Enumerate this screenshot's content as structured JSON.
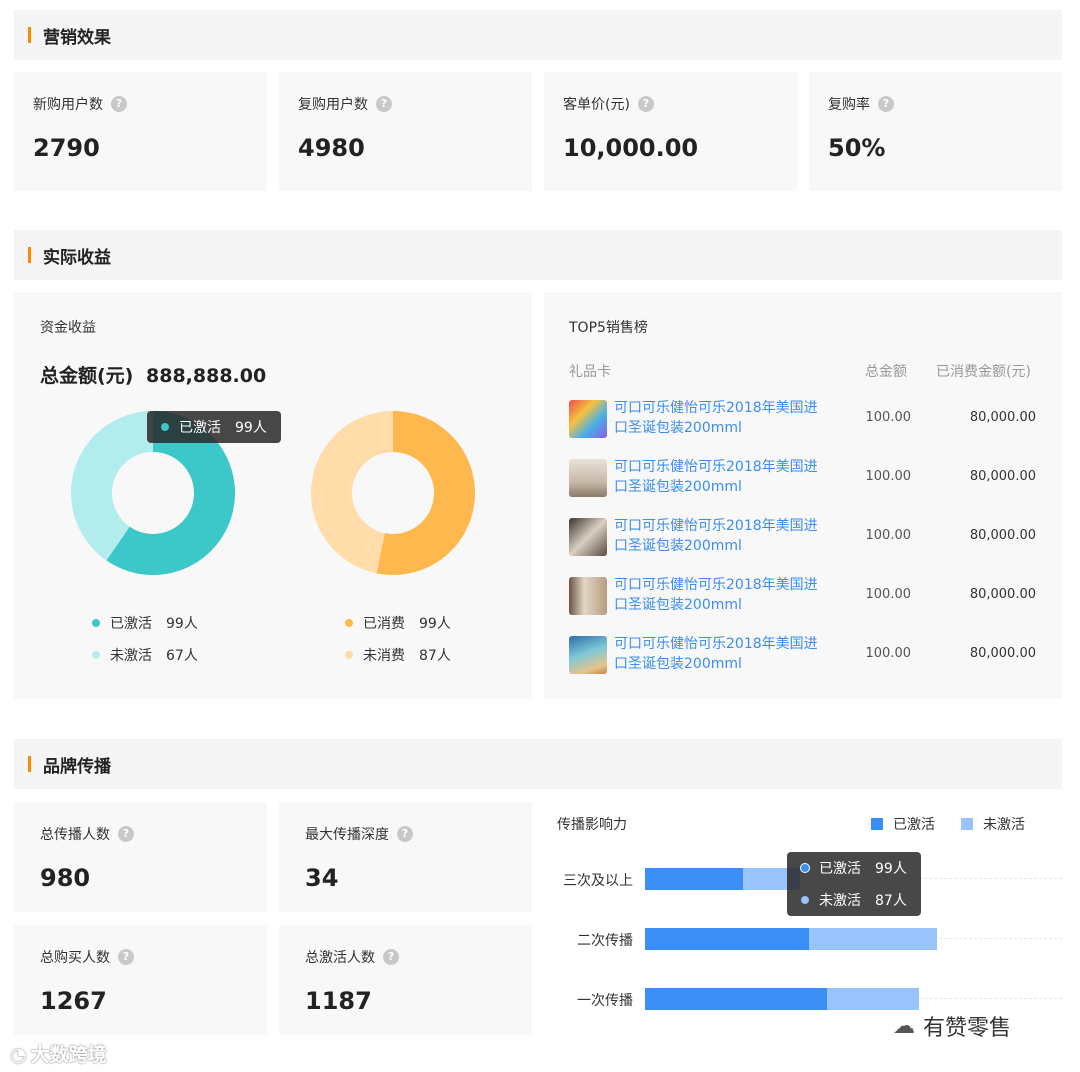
{
  "colors": {
    "accent": "#ff8a00",
    "teal": "#3cc8c8",
    "teal_light": "#b3ecec",
    "orange": "#ffb84d",
    "orange_light": "#ffdcaa",
    "blue": "#3a8ef6",
    "blue_light": "#99c4fb",
    "link": "#3b8ef0"
  },
  "marketing": {
    "title": "营销效果",
    "metrics": [
      {
        "label": "新购用户数",
        "value": "2790"
      },
      {
        "label": "复购用户数",
        "value": "4980"
      },
      {
        "label": "客单价(元)",
        "value": "10,000.00"
      },
      {
        "label": "复购率",
        "value": "50%"
      }
    ]
  },
  "revenue": {
    "title": "实际收益",
    "funds_title": "资金收益",
    "total_label": "总金额(元)",
    "total_value": "888,888.00",
    "tooltip": {
      "label": "已激活",
      "value": "99人"
    },
    "donut1": [
      {
        "label": "已激活",
        "value": "99人",
        "count": 99
      },
      {
        "label": "未激活",
        "value": "67人",
        "count": 67
      }
    ],
    "donut2": [
      {
        "label": "已消费",
        "value": "99人",
        "count": 99
      },
      {
        "label": "未消费",
        "value": "87人",
        "count": 87
      }
    ],
    "top5": {
      "title": "TOP5销售榜",
      "headers": {
        "name": "礼品卡",
        "amount": "总金额",
        "spent": "已消费金额(元)"
      },
      "items": [
        {
          "name": "可口可乐健怡可乐2018年美国进口圣诞包装200mml",
          "amount": "100.00",
          "spent": "80,000.00"
        },
        {
          "name": "可口可乐健怡可乐2018年美国进口圣诞包装200mml",
          "amount": "100.00",
          "spent": "80,000.00"
        },
        {
          "name": "可口可乐健怡可乐2018年美国进口圣诞包装200mml",
          "amount": "100.00",
          "spent": "80,000.00"
        },
        {
          "name": "可口可乐健怡可乐2018年美国进口圣诞包装200mml",
          "amount": "100.00",
          "spent": "80,000.00"
        },
        {
          "name": "可口可乐健怡可乐2018年美国进口圣诞包装200mml",
          "amount": "100.00",
          "spent": "80,000.00"
        }
      ]
    }
  },
  "brand": {
    "title": "品牌传播",
    "metrics": [
      {
        "label": "总传播人数",
        "value": "980"
      },
      {
        "label": "最大传播深度",
        "value": "34"
      },
      {
        "label": "总购买人数",
        "value": "1267"
      },
      {
        "label": "总激活人数",
        "value": "1187"
      }
    ],
    "influence": {
      "title": "传播影响力",
      "legend": [
        "已激活",
        "未激活"
      ],
      "tooltip": [
        {
          "label": "已激活",
          "value": "99人"
        },
        {
          "label": "未激活",
          "value": "87人"
        }
      ]
    }
  },
  "chart_data": {
    "type": "bar",
    "orientation": "horizontal",
    "stacked": true,
    "categories": [
      "三次及以上",
      "二次传播",
      "一次传播"
    ],
    "series": [
      {
        "name": "已激活",
        "values": [
          33,
          55,
          61
        ]
      },
      {
        "name": "未激活",
        "values": [
          19,
          43,
          31
        ]
      }
    ]
  },
  "watermark": {
    "left": "大数跨境",
    "right": "有赞零售"
  }
}
